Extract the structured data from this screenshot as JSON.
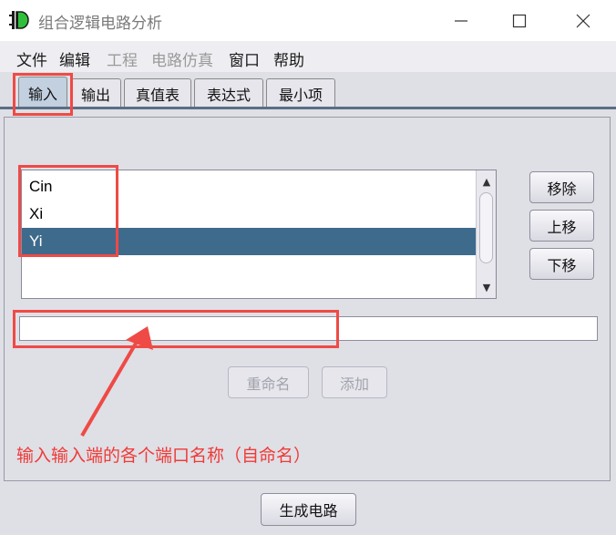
{
  "window": {
    "title": "组合逻辑电路分析",
    "minimize_icon": "minimize-icon",
    "maximize_icon": "maximize-icon",
    "close_icon": "close-icon"
  },
  "menu": {
    "items": [
      {
        "label": "文件",
        "enabled": true
      },
      {
        "label": "编辑",
        "enabled": true
      },
      {
        "label": "工程",
        "enabled": false
      },
      {
        "label": "电路仿真",
        "enabled": false
      },
      {
        "label": "窗口",
        "enabled": true
      },
      {
        "label": "帮助",
        "enabled": true
      }
    ]
  },
  "tabs": [
    {
      "label": "输入",
      "active": true
    },
    {
      "label": "输出",
      "active": false
    },
    {
      "label": "真值表",
      "active": false
    },
    {
      "label": "表达式",
      "active": false
    },
    {
      "label": "最小项",
      "active": false
    }
  ],
  "inputs_list": {
    "items": [
      {
        "label": "Cin",
        "selected": false
      },
      {
        "label": "Xi",
        "selected": false
      },
      {
        "label": "Yi",
        "selected": true
      }
    ]
  },
  "side_buttons": {
    "remove": "移除",
    "move_up": "上移",
    "move_down": "下移"
  },
  "name_field": {
    "value": "",
    "placeholder": ""
  },
  "actions": {
    "rename": "重命名",
    "add": "添加"
  },
  "generate_button": "生成电路",
  "annotation": {
    "text": "输入输入端的各个端口名称（自命名）",
    "color": "#ef3b36"
  },
  "colors": {
    "selection": "#3e6a8c",
    "highlight": "#ef4a45"
  }
}
